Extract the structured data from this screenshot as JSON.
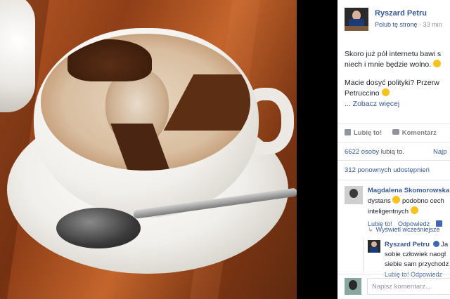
{
  "post": {
    "page_name": "Ryszard Petru",
    "like_page": "Polub tę stronę",
    "time": "· 33 min",
    "text_line1": "Skoro już pół internetu bawi s",
    "text_line2": "niech i mnie będzie wolno.",
    "text_line3": "Macie dosyć polityki? Przerw",
    "text_line4": "Petruccino",
    "see_more": "... Zobacz więcej"
  },
  "actions": {
    "like": "Lubię to!",
    "comment": "Komentarz"
  },
  "stats": {
    "likes_count": "6622 osoby",
    "likes_suffix": "lubią to.",
    "right_link": "Najp",
    "shares": "312 ponownych udostępnień"
  },
  "comment": {
    "author": "Magdalena Skomorowska",
    "line1_a": "dystans",
    "line1_b": "podobno cech",
    "line2": "inteligentnych",
    "like": "Lubię to!",
    "reply": "Odpowiedz"
  },
  "view_earlier": "Wyświetl wcześniejsze",
  "reply": {
    "author": "Ryszard Petru",
    "after_name": "Ja",
    "line1": "sobie człowiek naogl",
    "line2": "siebie sam przychodz",
    "links": "Lubię to!  Odpowiedz"
  },
  "composer": {
    "placeholder": "Napisz komentarz..."
  },
  "colors": {
    "link": "#365899",
    "muted": "#90949c",
    "background": "#000000"
  }
}
